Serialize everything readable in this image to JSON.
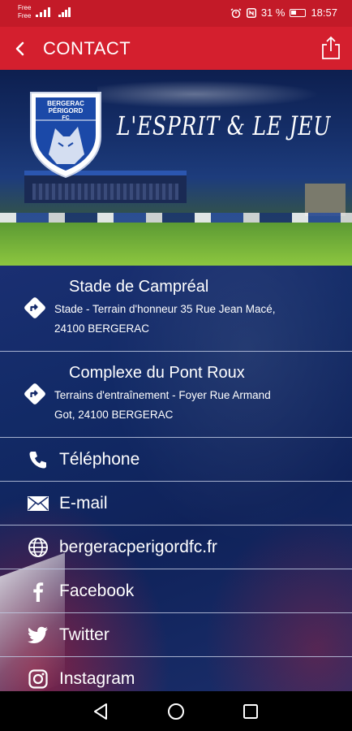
{
  "status_bar": {
    "carrier_1": "Free",
    "carrier_2": "Free",
    "battery_text": "31 %",
    "time": "18:57"
  },
  "app_bar": {
    "title": "CONTACT"
  },
  "hero": {
    "club_line_1": "BERGERAC",
    "club_line_2": "PÉRIGORD",
    "club_line_3": "FC",
    "slogan": "L'ESPRIT & LE JEU"
  },
  "locations": [
    {
      "name": "Stade de Campréal",
      "address_line_1": "Stade - Terrain d'honneur 35 Rue Jean Macé,",
      "address_line_2": "24100 BERGERAC",
      "icon": "directions-icon"
    },
    {
      "name": "Complexe du Pont Roux",
      "address_line_1": "Terrains d'entraînement - Foyer Rue Armand",
      "address_line_2": "Got, 24100 BERGERAC",
      "icon": "directions-icon"
    }
  ],
  "contacts": [
    {
      "label": "Téléphone",
      "icon": "phone-icon"
    },
    {
      "label": "E-mail",
      "icon": "mail-icon"
    },
    {
      "label": "bergeracperigordfc.fr",
      "icon": "globe-icon"
    },
    {
      "label": "Facebook",
      "icon": "facebook-icon"
    },
    {
      "label": "Twitter",
      "icon": "twitter-icon"
    },
    {
      "label": "Instagram",
      "icon": "instagram-icon"
    }
  ],
  "colors": {
    "accent_red": "#d41f2e",
    "status_red": "#c31a28",
    "navy": "#122a66"
  }
}
